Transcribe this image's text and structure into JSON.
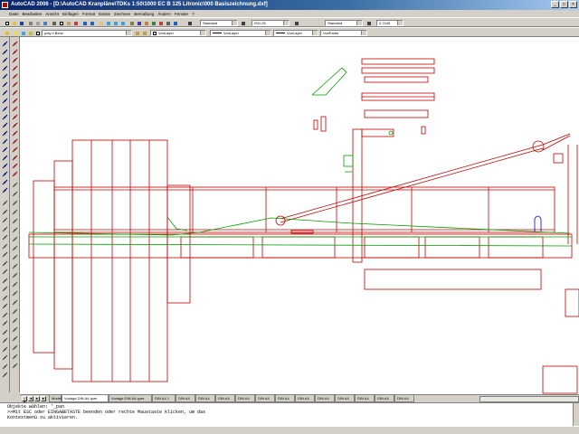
{
  "window": {
    "title": "AutoCAD 2006 - [D:\\AutoCAD Kranpläne\\TDKs 1:50\\1000 EC B 125 Litronic\\000 Basiszeichnung.dxf]",
    "buttons": [
      "_",
      "□",
      "×"
    ]
  },
  "menu": {
    "items": [
      "Datei",
      "Bearbeiten",
      "Ansicht",
      "Einfügen",
      "Format",
      "Extras",
      "Zeichnen",
      "Bemaßung",
      "Ändern",
      "Fenster",
      "?"
    ]
  },
  "toolbar1": {
    "text_style": "Standard",
    "dim_style": "ISO-25",
    "table_style": "Standard",
    "scale_value": "2,7445"
  },
  "toolbar2": {
    "layer": "poly 0 Benz",
    "color": "VonLayer",
    "linetype": "VonLayer",
    "lineweight": "VonLayer",
    "plotstyle": "VonFarbe"
  },
  "tabs": {
    "nav": [
      "|◄",
      "◄",
      "►",
      "►|"
    ],
    "items": [
      {
        "label": "Modell",
        "active": false
      },
      {
        "label": "Vorlage DIN A4 quer",
        "active": true
      },
      {
        "label": "Vorlage DIN A4 quer",
        "active": false
      },
      {
        "label": "DIN A4 1",
        "active": false
      },
      {
        "label": "DIN A4",
        "active": false
      },
      {
        "label": "DIN A4",
        "active": false
      },
      {
        "label": "DIN A4",
        "active": false
      },
      {
        "label": "DIN A4",
        "active": false
      },
      {
        "label": "DIN A4",
        "active": false
      },
      {
        "label": "DIN A4",
        "active": false
      },
      {
        "label": "DIN A4",
        "active": false
      },
      {
        "label": "DIN A4",
        "active": false
      },
      {
        "label": "DIN A4",
        "active": false
      },
      {
        "label": "DIN A4",
        "active": false
      },
      {
        "label": "DIN A4",
        "active": false
      },
      {
        "label": "DIN A4",
        "active": false
      }
    ]
  },
  "command": {
    "lines": [
      "Objekte wählen: '_pan",
      ">>Mit ESC oder EINGABETASTE beenden oder rechte Maustaste klicken, um das",
      "Kontextmenü zu aktivieren."
    ]
  },
  "colors": {
    "drawing_red": "#c00000",
    "drawing_green": "#00a000",
    "drawing_blue": "#0000c0",
    "titlebar": "#0a246a"
  }
}
